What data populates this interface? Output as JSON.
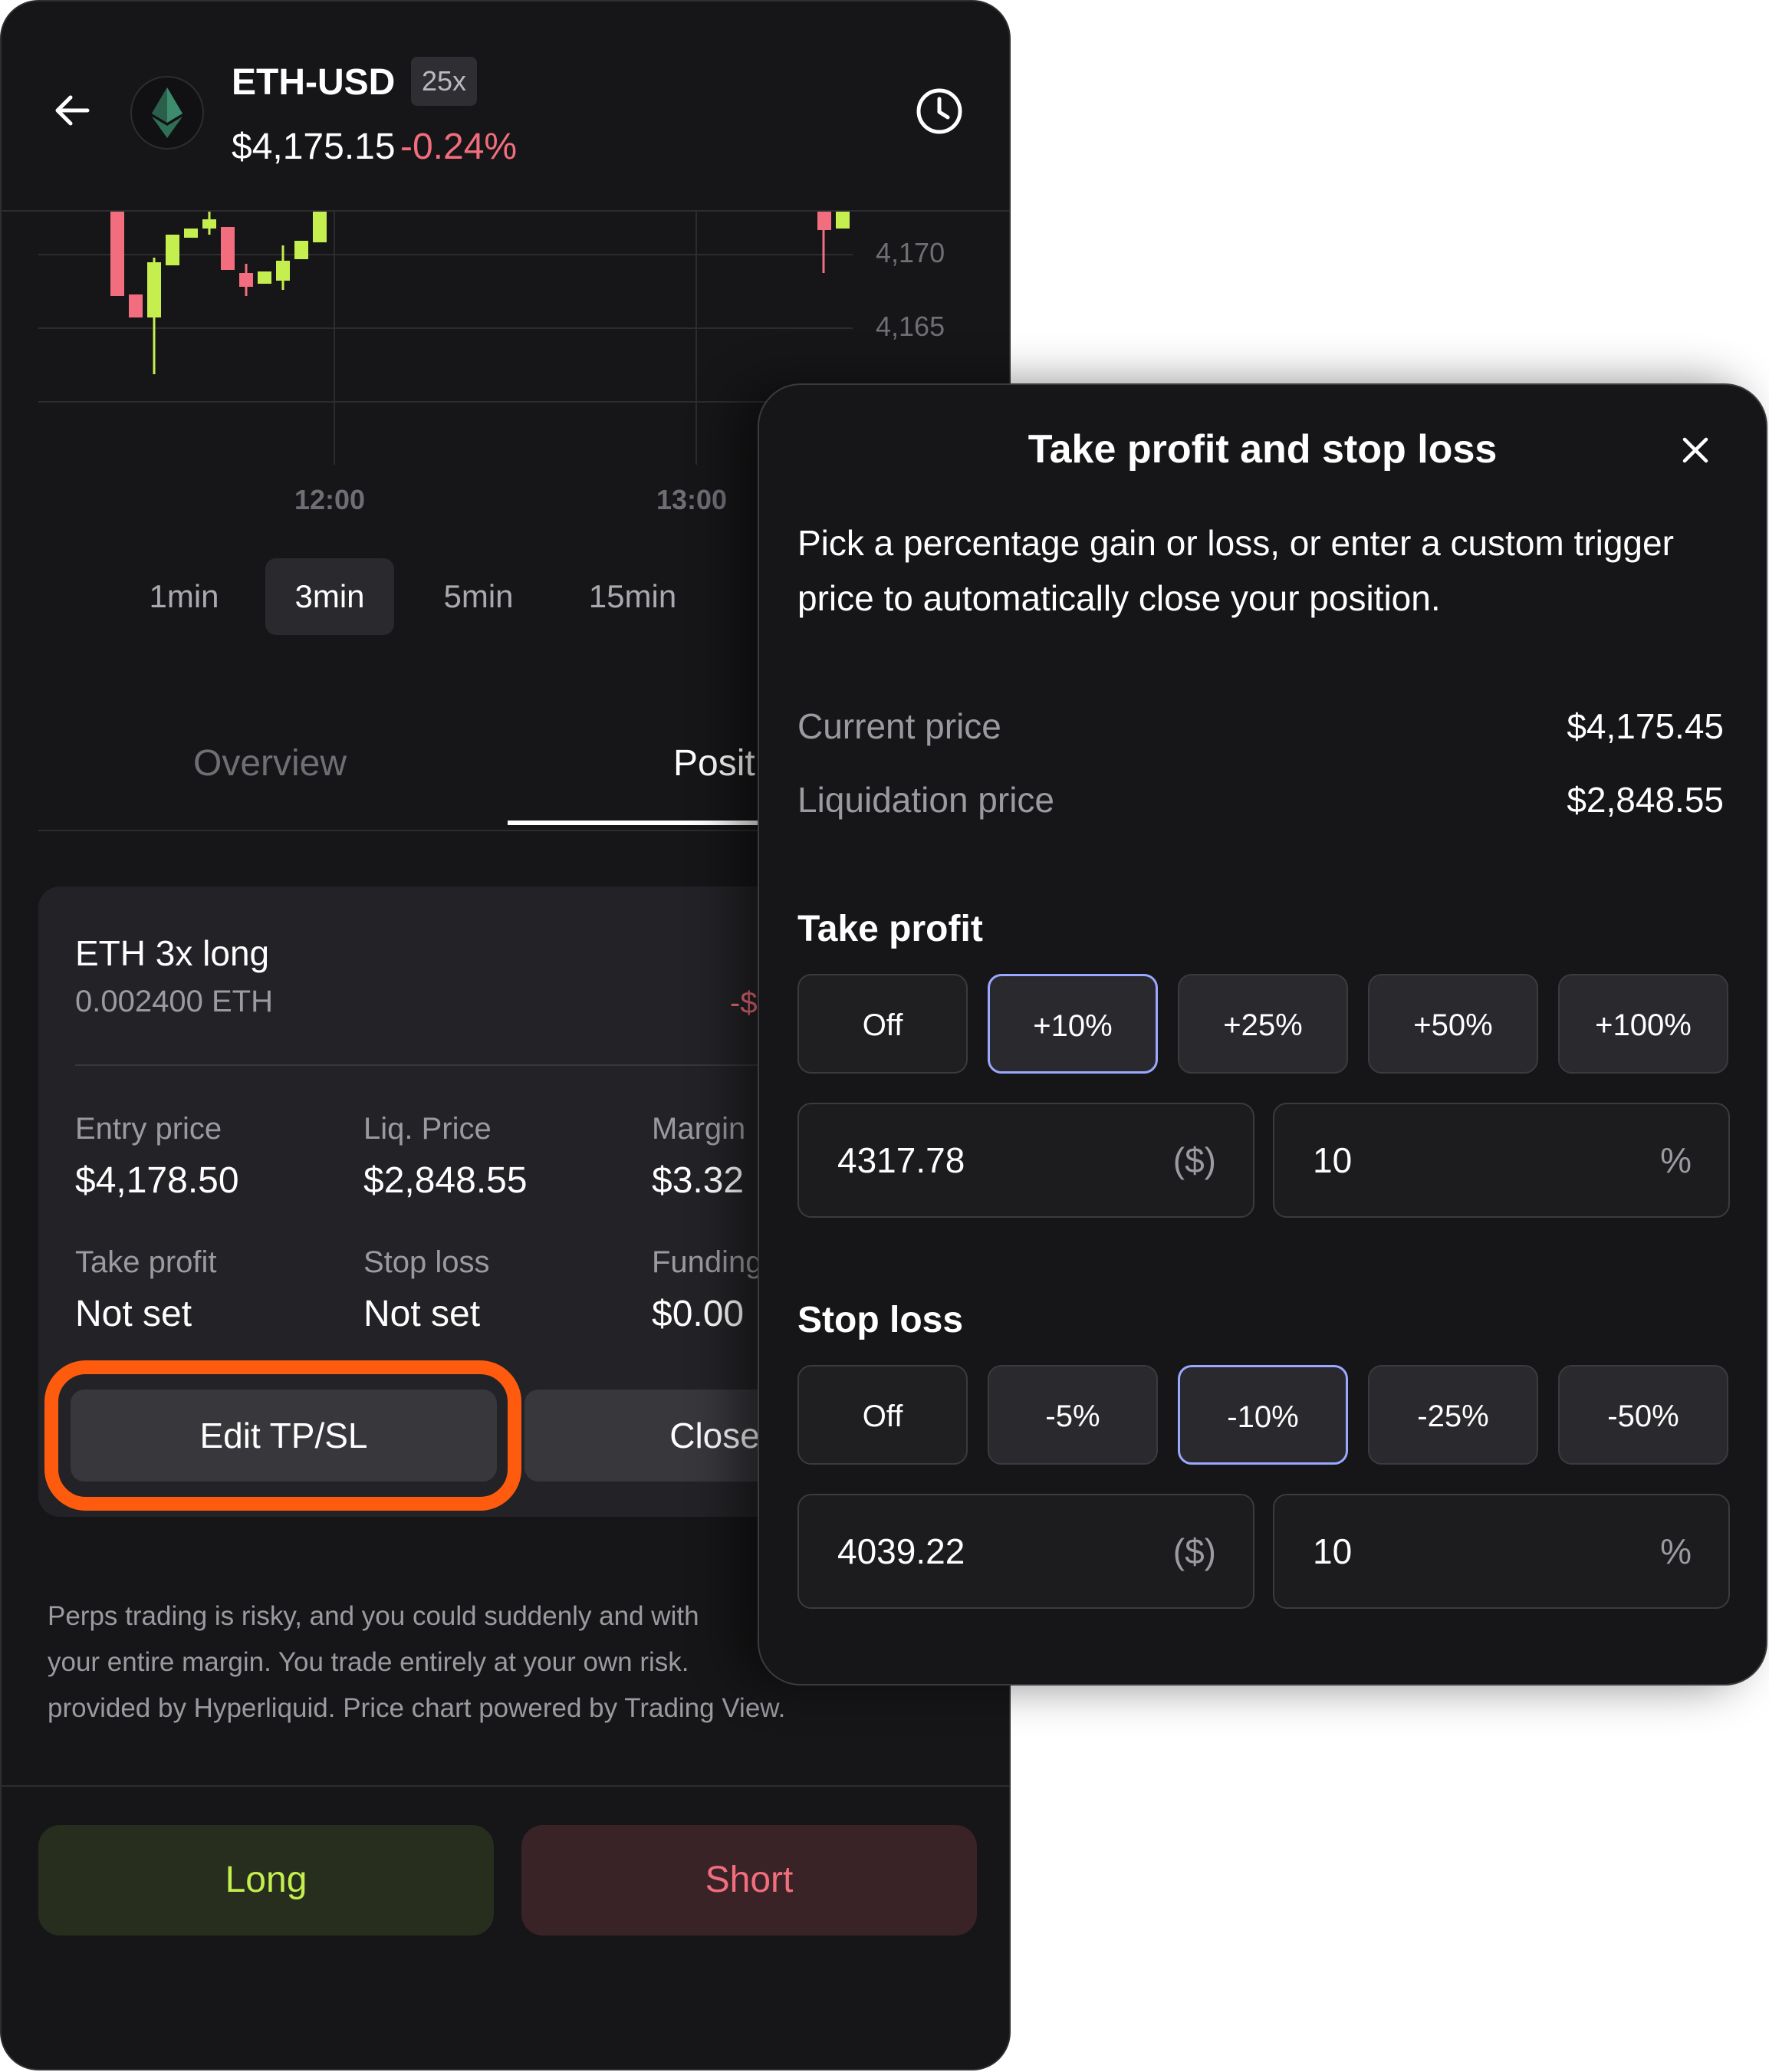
{
  "header": {
    "symbol": "ETH-USD",
    "leverage": "25x",
    "price": "$4,175.15",
    "change": "-0.24%"
  },
  "chart": {
    "price_labels": [
      "4,170",
      "4,165"
    ],
    "time_labels": [
      "12:00",
      "13:00"
    ]
  },
  "timeframes": [
    {
      "label": "1min",
      "selected": false
    },
    {
      "label": "3min",
      "selected": true
    },
    {
      "label": "5min",
      "selected": false
    },
    {
      "label": "15min",
      "selected": false
    }
  ],
  "tabs": {
    "overview": "Overview",
    "positions": "Posit"
  },
  "position": {
    "title": "ETH 3x long",
    "size": "0.002400 ETH",
    "pnl": "-$",
    "entry_label": "Entry price",
    "entry_value": "$4,178.50",
    "liq_label": "Liq. Price",
    "liq_value": "$2,848.55",
    "margin_label": "Margin",
    "margin_value": "$3.32",
    "tp_label": "Take profit",
    "tp_value": "Not set",
    "sl_label": "Stop loss",
    "sl_value": "Not set",
    "funding_label": "Funding",
    "funding_value": "$0.00",
    "edit_button": "Edit TP/SL",
    "close_button": "Close po"
  },
  "disclaimer": {
    "line1": "Perps trading is risky, and you could suddenly and with",
    "line2": "your entire margin. You trade entirely at your own risk.",
    "line3": "provided by Hyperliquid. Price chart powered by Trading View."
  },
  "actions": {
    "long": "Long",
    "short": "Short"
  },
  "modal": {
    "title": "Take profit and stop loss",
    "description": "Pick a percentage gain or loss, or enter a custom trigger price to automatically close your position.",
    "current_price_label": "Current price",
    "current_price_value": "$4,175.45",
    "liq_price_label": "Liquidation price",
    "liq_price_value": "$2,848.55",
    "take_profit": {
      "heading": "Take profit",
      "options": [
        "Off",
        "+10%",
        "+25%",
        "+50%",
        "+100%"
      ],
      "selected_index": 1,
      "price_value": "4317.78",
      "price_unit": "($)",
      "percent_value": "10",
      "percent_unit": "%"
    },
    "stop_loss": {
      "heading": "Stop loss",
      "options": [
        "Off",
        "-5%",
        "-10%",
        "-25%",
        "-50%"
      ],
      "selected_index": 2,
      "price_value": "4039.22",
      "price_unit": "($)",
      "percent_value": "10",
      "percent_unit": "%"
    }
  },
  "colors": {
    "accent_highlight": "#ff5b0e",
    "negative": "#f26d7d",
    "positive": "#c4ef4f",
    "selected_chip": "#9aa8ff"
  }
}
